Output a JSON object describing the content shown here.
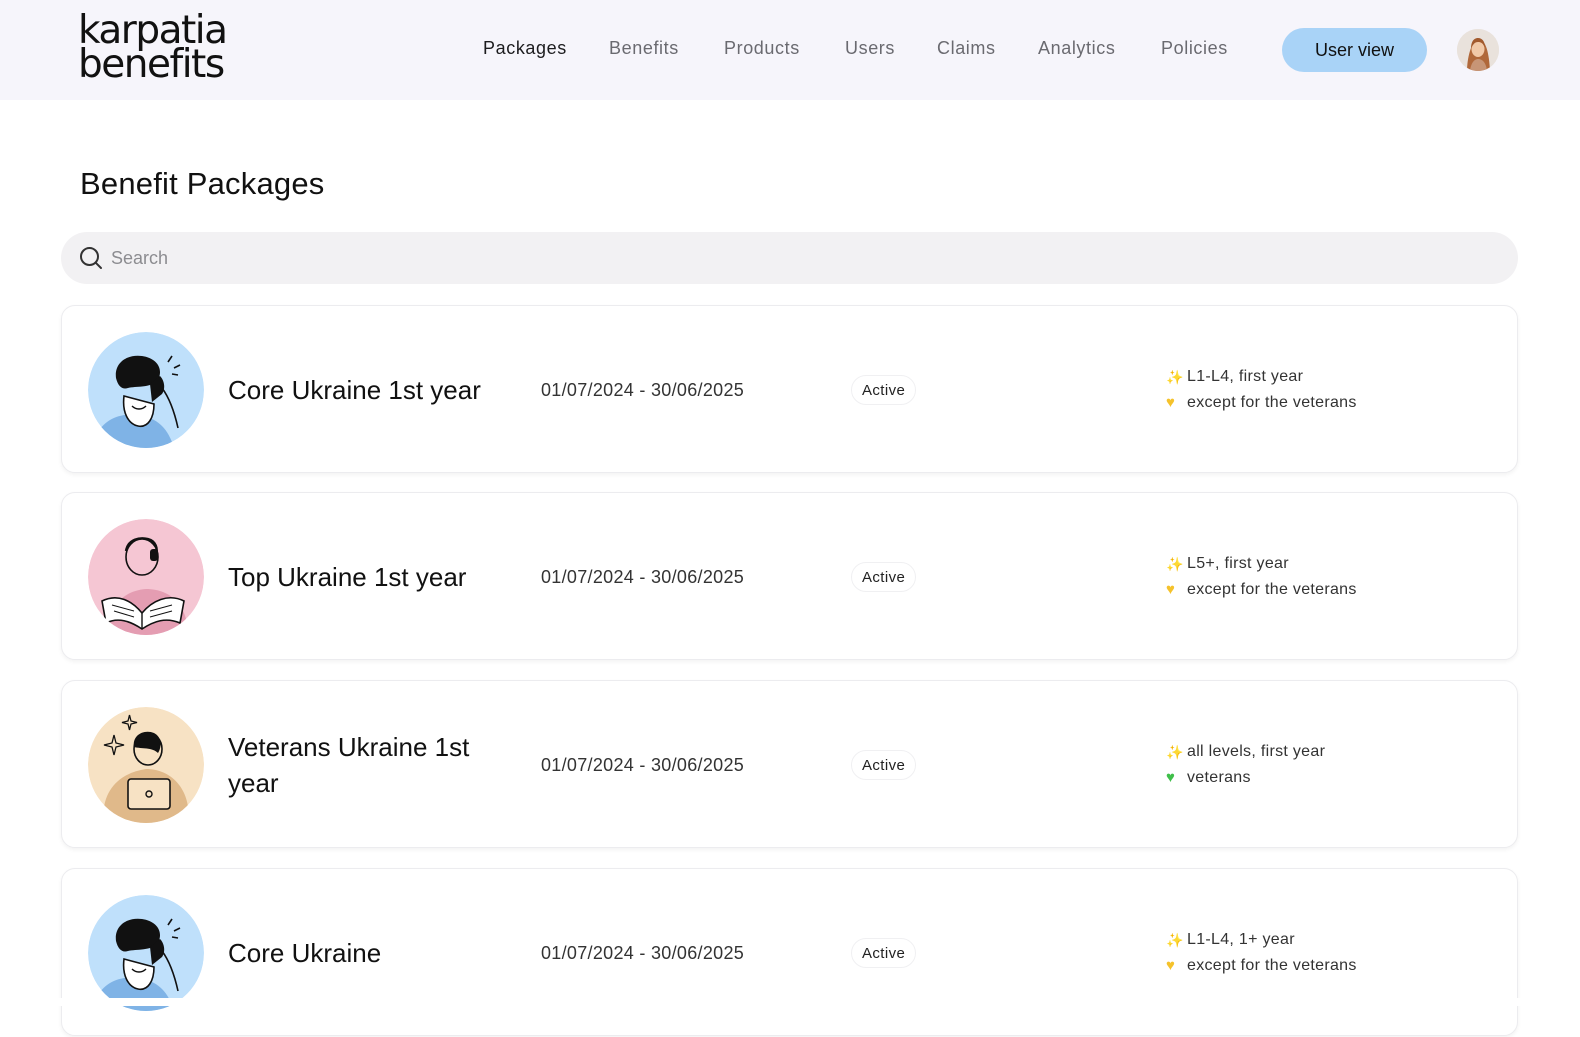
{
  "brand": {
    "line1": "karpatia",
    "line2": "benefits"
  },
  "nav": {
    "items": [
      {
        "label": "Packages",
        "active": true
      },
      {
        "label": "Benefits",
        "active": false
      },
      {
        "label": "Products",
        "active": false
      },
      {
        "label": "Users",
        "active": false
      },
      {
        "label": "Claims",
        "active": false
      },
      {
        "label": "Analytics",
        "active": false
      },
      {
        "label": "Policies",
        "active": false
      }
    ],
    "user_view_label": "User view"
  },
  "page": {
    "title": "Benefit Packages"
  },
  "search": {
    "placeholder": "Search",
    "value": ""
  },
  "packages": [
    {
      "name": "Core Ukraine 1st year",
      "dates": "01/07/2024 - 30/06/2025",
      "status": "Active",
      "eligibility": "L1-L4, first year",
      "note": "except for the veterans",
      "note_icon": "yellow-heart-icon",
      "illustration": "person-on-phone",
      "illustration_bg": "#bfe0fb"
    },
    {
      "name": "Top Ukraine 1st year",
      "dates": "01/07/2024 - 30/06/2025",
      "status": "Active",
      "eligibility": "L5+, first year",
      "note": "except for the veterans",
      "note_icon": "yellow-heart-icon",
      "illustration": "person-reading",
      "illustration_bg": "#f5c6d3"
    },
    {
      "name": "Veterans Ukraine 1st year",
      "dates": "01/07/2024 - 30/06/2025",
      "status": "Active",
      "eligibility": "all levels, first year",
      "note": "veterans",
      "note_icon": "green-heart-icon",
      "illustration": "person-with-laptop",
      "illustration_bg": "#f7e2c4"
    },
    {
      "name": "Core Ukraine",
      "dates": "01/07/2024 - 30/06/2025",
      "status": "Active",
      "eligibility": "L1-L4, 1+ year",
      "note": "except for the veterans",
      "note_icon": "yellow-heart-icon",
      "illustration": "person-on-phone",
      "illustration_bg": "#bfe0fb"
    }
  ]
}
